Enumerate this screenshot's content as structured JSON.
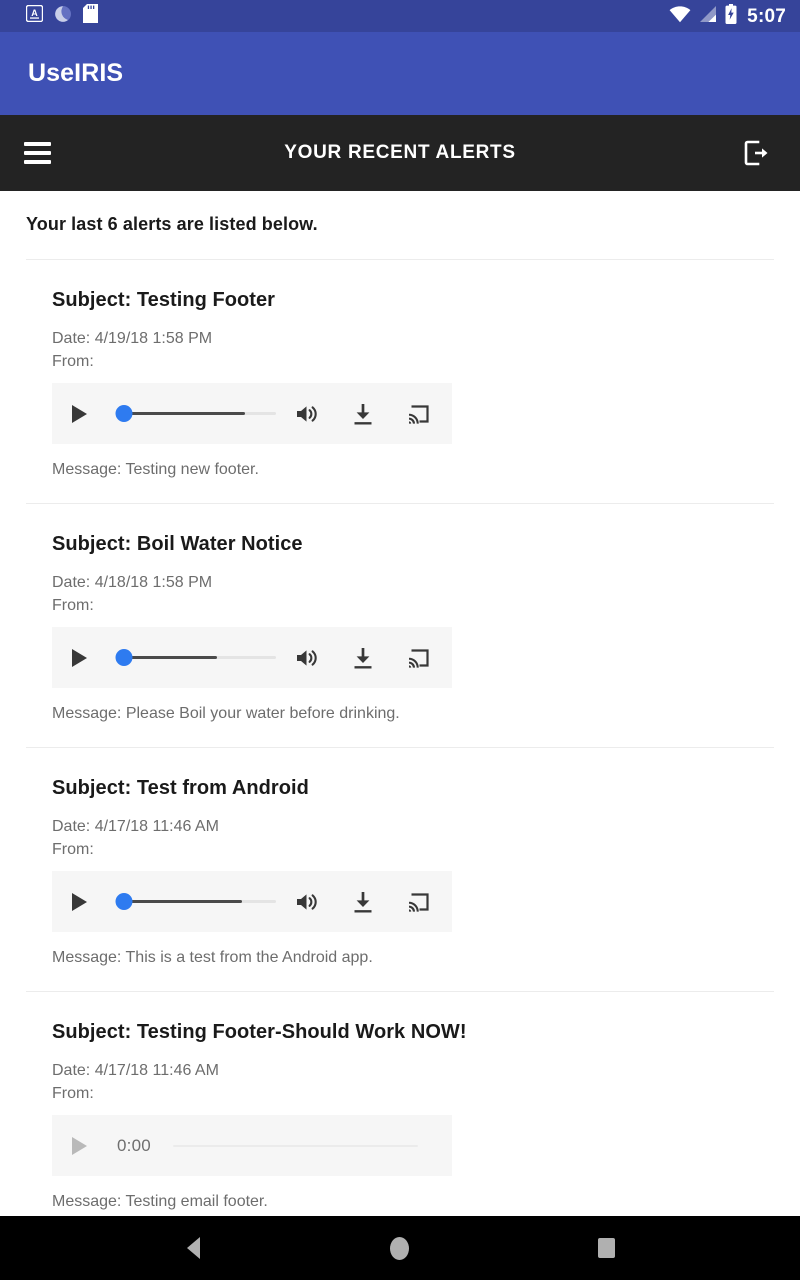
{
  "status_bar": {
    "clock": "5:07",
    "icons_left": [
      "input-method-a-icon",
      "dnd-moon-icon",
      "sd-card-icon"
    ],
    "icons_right": [
      "wifi-icon",
      "signal-cellular-icon",
      "battery-charging-icon"
    ],
    "background": "#36449a"
  },
  "brand_bar": {
    "title": "UseIRIS",
    "background": "#3f51b5"
  },
  "dark_bar": {
    "title": "YOUR RECENT ALERTS",
    "menu_icon": "hamburger-menu-icon",
    "logout_icon": "logout-icon",
    "background": "#232323"
  },
  "page": {
    "intro": "Your last 6 alerts are listed below.",
    "accent_color": "#2e7bf0"
  },
  "alerts": [
    {
      "subject": "Subject: Testing Footer",
      "date": "Date: 4/19/18 1:58 PM",
      "from": "From:",
      "message": "Message: Testing new footer.",
      "player": {
        "state": "ready",
        "play_label": "play-icon",
        "progress_percent": 0,
        "fill_percent": 80,
        "controls": [
          "volume-icon",
          "download-icon",
          "cast-icon"
        ]
      }
    },
    {
      "subject": "Subject: Boil Water Notice",
      "date": "Date: 4/18/18 1:58 PM",
      "from": "From:",
      "message": "Message: Please Boil your water before drinking.",
      "player": {
        "state": "ready",
        "play_label": "play-icon",
        "progress_percent": 0,
        "fill_percent": 62,
        "controls": [
          "volume-icon",
          "download-icon",
          "cast-icon"
        ]
      }
    },
    {
      "subject": "Subject: Test from Android",
      "date": "Date: 4/17/18 11:46 AM",
      "from": "From:",
      "message": "Message: This is a test from the Android app.",
      "player": {
        "state": "ready",
        "play_label": "play-icon",
        "progress_percent": 0,
        "fill_percent": 78,
        "controls": [
          "volume-icon",
          "download-icon",
          "cast-icon"
        ]
      }
    },
    {
      "subject": "Subject: Testing Footer-Should Work NOW!",
      "date": "Date: 4/17/18 11:46 AM",
      "from": "From:",
      "message": "Message: Testing email footer.",
      "player": {
        "state": "loading",
        "play_label": "play-icon-disabled",
        "time": "0:00",
        "controls": []
      }
    }
  ],
  "nav_bar": {
    "buttons": [
      "back-button",
      "home-button",
      "recents-button"
    ],
    "background": "#000000"
  }
}
